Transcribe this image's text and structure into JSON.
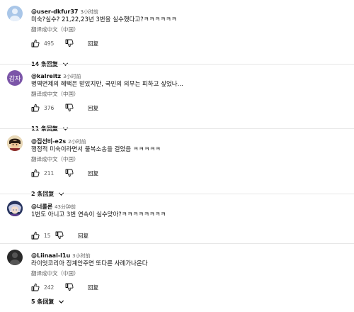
{
  "ui": {
    "translate_label": "翻译成中文（中国）",
    "reply_label": "回复"
  },
  "comments": [
    {
      "handle": "@user-dkfur37",
      "time": "3小时前",
      "text": "미숙?실수? 21,22,23년 3번을 실수했다고?ㅋㅋㅋㅋㅋㅋ",
      "likes": "495",
      "replies": "14 条回复",
      "avatar": {
        "text": "",
        "bg": "#a9c6e8"
      }
    },
    {
      "handle": "@kalreitz",
      "time": "3小时前",
      "text": "병역면제의 혜택은 받았지만, 국민의 의무는 피하고 싶었나...",
      "likes": "376",
      "replies": "11 条回复",
      "avatar": {
        "text": "감자",
        "bg": "#7b55a8"
      }
    },
    {
      "handle": "@집선비-e2s",
      "time": "2小时前",
      "text": "행정적 미숙이라면서 불복소송을 걸었음 ㅋㅋㅋㅋㅋ",
      "likes": "211",
      "replies": "2 条回复",
      "avatar": {
        "text": "",
        "bg": "#c8a070"
      }
    },
    {
      "handle": "@너롤론",
      "time": "43分钟前",
      "text": "1번도 아니고 3번 연속이 실수맞아?ㅋㅋㅋㅋㅋㅋㅋㅋ",
      "likes": "15",
      "replies": "2 条回复",
      "avatar": {
        "text": "",
        "bg": "#3a4f8a"
      }
    },
    {
      "handle": "@Liinaal-l1u",
      "time": "3小时前",
      "text": "라이엇코리아 징계안주면 또다른 사례가나온다",
      "likes": "242",
      "replies": "5 条回复",
      "avatar": {
        "text": "",
        "bg": "#2a2a2a"
      }
    }
  ]
}
